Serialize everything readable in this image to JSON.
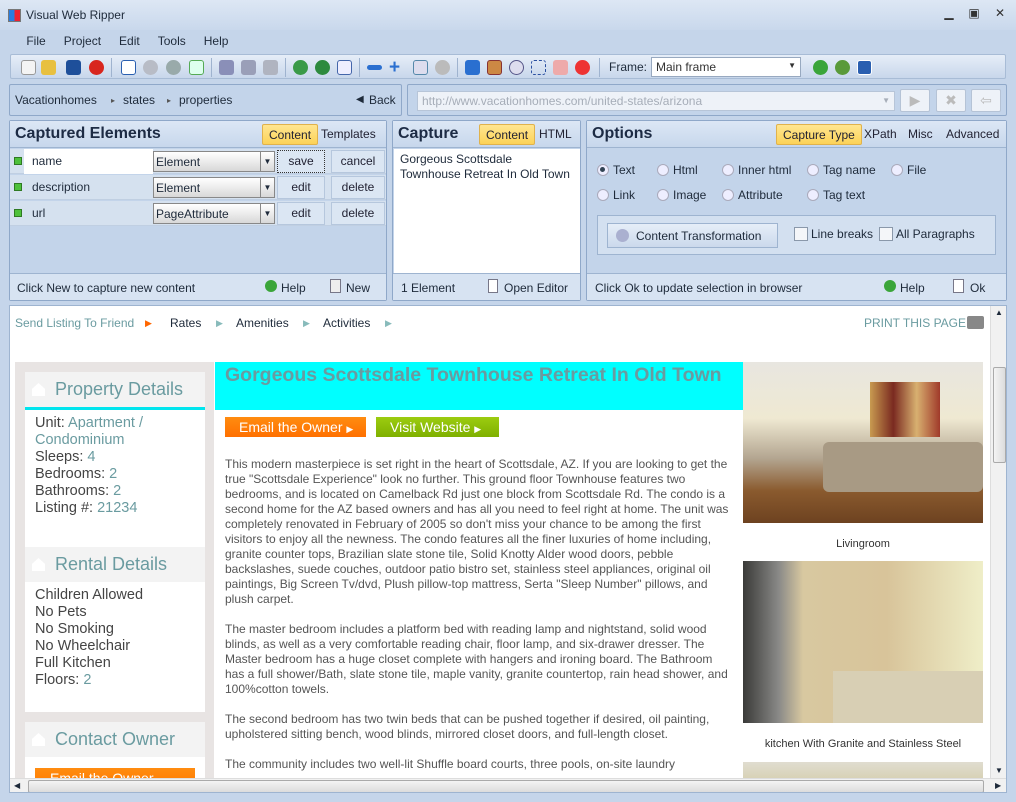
{
  "window": {
    "title": "Visual Web Ripper",
    "minimize": "▁",
    "restore": "▣",
    "close": "✕"
  },
  "menu": [
    "File",
    "Project",
    "Edit",
    "Tools",
    "Help"
  ],
  "toolbar": {
    "frame_label": "Frame:",
    "frame_value": "Main frame"
  },
  "breadcrumb": {
    "items": [
      "Vacationhomes",
      "states",
      "properties"
    ],
    "back": "Back"
  },
  "url": {
    "value": "http://www.vacationhomes.com/united-states/arizona"
  },
  "captured": {
    "title": "Captured Elements",
    "tabs": [
      "Content",
      "Templates"
    ],
    "rows": [
      {
        "name": "name",
        "type": "Element",
        "btn1": "save",
        "btn2": "cancel"
      },
      {
        "name": "description",
        "type": "Element",
        "btn1": "edit",
        "btn2": "delete"
      },
      {
        "name": "url",
        "type": "PageAttribute",
        "btn1": "edit",
        "btn2": "delete"
      }
    ],
    "footer": "Click New to capture new content",
    "help": "Help",
    "new": "New"
  },
  "capture": {
    "title": "Capture",
    "tabs": [
      "Content",
      "HTML"
    ],
    "content": "Gorgeous Scottsdale Townhouse Retreat In Old Town",
    "count": "1 Element",
    "open_editor": "Open Editor"
  },
  "options": {
    "title": "Options",
    "tabs": [
      "Capture Type",
      "XPath",
      "Misc",
      "Advanced"
    ],
    "radios": [
      "Text",
      "Html",
      "Inner html",
      "Tag name",
      "File",
      "Link",
      "Image",
      "Attribute",
      "Tag text"
    ],
    "selected": "Text",
    "transform": "Content Transformation",
    "line_breaks": "Line breaks",
    "all_paragraphs": "All Paragraphs",
    "footer": "Click Ok to update selection in browser",
    "help": "Help",
    "ok": "Ok"
  },
  "page": {
    "nav": [
      "Send Listing To Friend",
      "Rates",
      "Amenities",
      "Activities"
    ],
    "print": "PRINT THIS PAGE",
    "property": {
      "title": "Property Details",
      "unit_label": "Unit: ",
      "unit": "Apartment / Condominium",
      "sleeps_label": "Sleeps: ",
      "sleeps": "4",
      "bedrooms_label": "Bedrooms: ",
      "bedrooms": "2",
      "bathrooms_label": "Bathrooms: ",
      "bathrooms": "2",
      "listing_label": "Listing #: ",
      "listing": "21234"
    },
    "rental": {
      "title": "Rental Details",
      "items": [
        "Children Allowed",
        "No Pets",
        "No Smoking",
        "No Wheelchair",
        "Full Kitchen"
      ],
      "floors_label": "Floors: ",
      "floors": "2"
    },
    "contact": {
      "title": "Contact Owner",
      "email": "Email the Owner"
    },
    "title": "Gorgeous Scottsdale Townhouse Retreat In Old Town",
    "email_btn": "Email the Owner",
    "website_btn": "Visit Website",
    "paragraphs": [
      "This modern masterpiece is set right in the heart of Scottsdale, AZ. If you are looking to get the true \"Scottsdale Experience\" look no further. This ground floor Townhouse features two bedrooms, and is located on Camelback Rd just one block from Scottsdale Rd. The condo is a second home for the AZ based owners and has all you need to feel right at home. The unit was completely renovated in February of 2005 so don't miss your chance to be among the first visitors to enjoy all the newness. The condo features all the finer luxuries of home including, granite counter tops, Brazilian slate stone tile, Solid Knotty Alder wood doors, pebble backslashes, suede couches, outdoor patio bistro set, stainless steel appliances, original oil paintings, Big Screen Tv/dvd, Plush pillow-top mattress, Serta \"Sleep Number\" pillows, and plush carpet.",
      "The master bedroom includes a platform bed with reading lamp and nightstand, solid wood blinds, as well as a very comfortable reading chair, floor lamp, and six-drawer dresser. The Master bedroom has a huge closet complete with hangers and ironing board. The Bathroom has a full shower/Bath, slate stone tile, maple vanity, granite countertop, rain head shower, and 100%cotton towels.",
      "The second bedroom has two twin beds that can be pushed together if desired, oil painting, upholstered sitting bench, wood blinds, mirrored closet doors, and full-length closet.",
      "The community includes two well-lit Shuffle board courts, three pools, on-site laundry"
    ],
    "captions": [
      "Livingroom",
      "kitchen With Granite and Stainless Steel"
    ]
  }
}
